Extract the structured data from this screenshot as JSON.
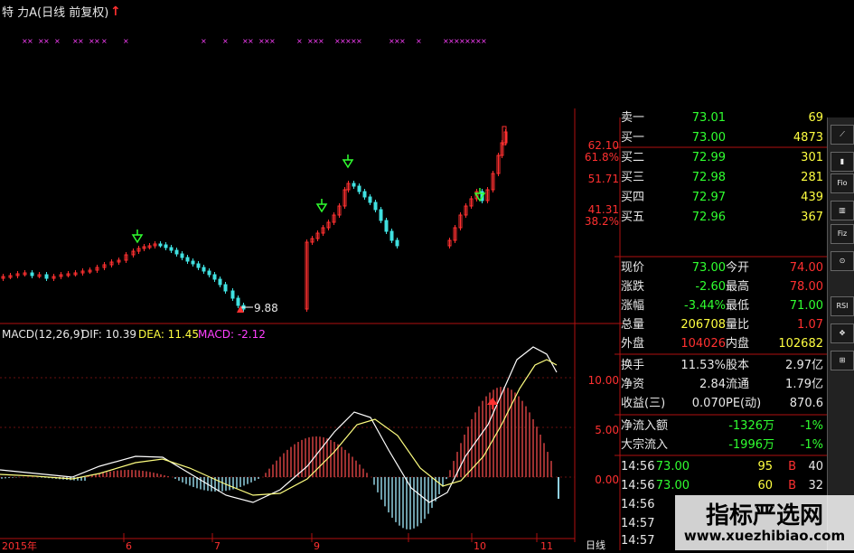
{
  "header": {
    "title": "特  力A(日线 前复权)",
    "up_arrow": "↑"
  },
  "price_chart": {
    "low_marker": "9.88",
    "axis_labels": [
      "62.10",
      "61.8%",
      "51.71",
      "41.31",
      "38.2%"
    ]
  },
  "macd": {
    "label": "MACD(12,26,9)",
    "dif_label": "DIF: 10.39",
    "dea_label": "DEA: 11.45",
    "macd_label": "MACD: -2.12",
    "axis_labels": [
      "10.00",
      "5.00",
      "0.00"
    ]
  },
  "date_axis": {
    "labels": [
      "2015年",
      "6",
      "7",
      "9",
      "10",
      "11"
    ],
    "period_label": "日线"
  },
  "quote_panel": {
    "sell_rows": [
      {
        "label": "卖一",
        "price": "73.01",
        "vol": "69"
      }
    ],
    "buy_rows": [
      {
        "label": "买一",
        "price": "73.00",
        "vol": "4873"
      },
      {
        "label": "买二",
        "price": "72.99",
        "vol": "301"
      },
      {
        "label": "买三",
        "price": "72.98",
        "vol": "281"
      },
      {
        "label": "买四",
        "price": "72.97",
        "vol": "439"
      },
      {
        "label": "买五",
        "price": "72.96",
        "vol": "367"
      }
    ],
    "stats": [
      {
        "l1": "现价",
        "v1": "73.00",
        "l2": "今开",
        "v2": "74.00"
      },
      {
        "l1": "涨跌",
        "v1": "-2.60",
        "l2": "最高",
        "v2": "78.00"
      },
      {
        "l1": "涨幅",
        "v1": "-3.44%",
        "l2": "最低",
        "v2": "71.00"
      },
      {
        "l1": "总量",
        "v1": "206708",
        "l2": "量比",
        "v2": "1.07"
      },
      {
        "l1": "外盘",
        "v1": "104026",
        "l2": "内盘",
        "v2": "102682"
      }
    ],
    "fundamentals": [
      {
        "l1": "换手",
        "v1": "11.53%",
        "l2": "股本",
        "v2": "2.97亿"
      },
      {
        "l1": "净资",
        "v1": "2.84",
        "l2": "流通",
        "v2": "1.79亿"
      },
      {
        "l1": "收益(三)",
        "v1": "0.070",
        "l2": "PE(动)",
        "v2": "870.6"
      }
    ],
    "flows": [
      {
        "label": "净流入额",
        "amount": "-1326万",
        "pct": "-1%"
      },
      {
        "label": "大宗流入",
        "amount": "-1996万",
        "pct": "-1%"
      }
    ],
    "ticks": [
      {
        "time": "14:56",
        "price": "73.00",
        "vol": "95",
        "side": "B",
        "count": "40"
      },
      {
        "time": "14:56",
        "price": "73.00",
        "vol": "60",
        "side": "B",
        "count": "32"
      },
      {
        "time": "14:56",
        "price": "",
        "vol": "",
        "side": "",
        "count": ""
      },
      {
        "time": "14:57",
        "price": "",
        "vol": "",
        "side": "",
        "count": ""
      },
      {
        "time": "14:57",
        "price": "",
        "vol": "",
        "side": "",
        "count": ""
      }
    ]
  },
  "toolbar": {
    "buttons": [
      "",
      "",
      "Fio",
      "",
      "Fiz",
      "",
      "RSI",
      "",
      ""
    ]
  },
  "watermark": {
    "title": "指标严选网",
    "url": "www.xuezhibiao.com"
  },
  "colors": {
    "up": "#ff3030",
    "down": "#40e0e0",
    "dif_line": "#ffffff",
    "dea_line": "#ffff80",
    "grid": "#b01010"
  }
}
